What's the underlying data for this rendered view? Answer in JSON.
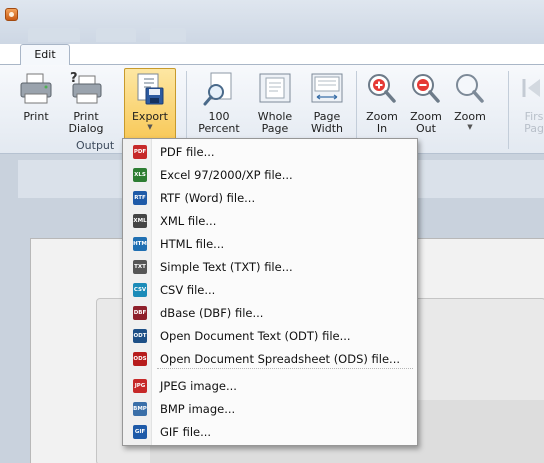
{
  "ribbon": {
    "tab_edit": "Edit",
    "buttons": {
      "print": "Print",
      "print_dialog_1": "Print",
      "print_dialog_2": "Dialog",
      "export": "Export",
      "percent_1": "100",
      "percent_2": "Percent",
      "whole_1": "Whole",
      "whole_2": "Page",
      "width_1": "Page",
      "width_2": "Width",
      "zoomin_1": "Zoom",
      "zoomin_2": "In",
      "zoomout_1": "Zoom",
      "zoomout_2": "Out",
      "zoom": "Zoom",
      "first_1": "Firs",
      "first_2": "Pag"
    },
    "group_output": "Output",
    "icons": {
      "print": "printer-icon",
      "print_dialog": "printer-question-icon",
      "export": "export-disk-icon",
      "percent": "magnifier-page-icon",
      "whole": "whole-page-icon",
      "width": "page-width-icon",
      "zoom_in": "zoom-in-icon",
      "zoom_out": "zoom-out-icon",
      "zoom": "zoom-icon",
      "first": "first-page-icon"
    }
  },
  "export_menu": {
    "items": [
      {
        "label": "PDF file...",
        "badge": "PDF",
        "color": "#c62828"
      },
      {
        "label": "Excel 97/2000/XP file...",
        "badge": "XLS",
        "color": "#2e7d32"
      },
      {
        "label": "RTF (Word) file...",
        "badge": "RTF",
        "color": "#1e5aa8"
      },
      {
        "label": "XML file...",
        "badge": "XML",
        "color": "#444444"
      },
      {
        "label": "HTML file...",
        "badge": "HTM",
        "color": "#1f6fb2"
      },
      {
        "label": "Simple Text (TXT) file...",
        "badge": "TXT",
        "color": "#555555"
      },
      {
        "label": "CSV file...",
        "badge": "CSV",
        "color": "#1b8bb8"
      },
      {
        "label": "dBase (DBF) file...",
        "badge": "DBF",
        "color": "#8e1f2a"
      },
      {
        "label": "Open Document Text (ODT) file...",
        "badge": "ODT",
        "color": "#1d4f86"
      },
      {
        "label": "Open Document Spreadsheet (ODS) file...",
        "badge": "ODS",
        "color": "#b71c1c"
      },
      {
        "label": "JPEG image...",
        "badge": "JPG",
        "color": "#c62828"
      },
      {
        "label": "BMP image...",
        "badge": "BMP",
        "color": "#3a6fa8"
      },
      {
        "label": "GIF file...",
        "badge": "GIF",
        "color": "#1e5aa8"
      }
    ]
  },
  "colors": {
    "accent": "#f8c857",
    "menu_bg": "#fbfbfb"
  }
}
